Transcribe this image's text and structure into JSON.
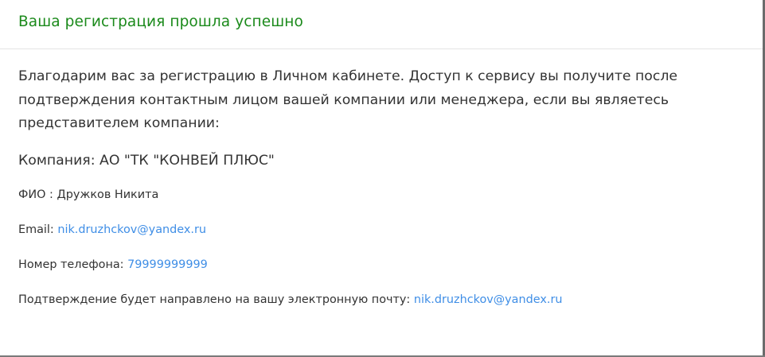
{
  "modal": {
    "title": "Ваша регистрация прошла успешно",
    "intro": "Благодарим вас за регистрацию в Личном кабинете. Доступ к сервису вы получите после подтверждения контактным лицом вашей компании или менеджера, если вы являетесь представителем компании:",
    "company": "Компания: АО \"ТК \"КОНВЕЙ ПЛЮС\"",
    "fio": "ФИО : Дружков Никита",
    "email_label": "Email: ",
    "email_value": "nik.druzhckov@yandex.ru",
    "phone_label": "Номер телефона: ",
    "phone_value": "79999999999",
    "confirm_label": "Подтверждение будет направлено на вашу электронную почту: ",
    "confirm_email": "nik.druzhckov@yandex.ru"
  },
  "colors": {
    "title": "#1b8a1b",
    "link": "#3f8ee6",
    "text": "#333333",
    "backdrop": "#5a5a5a"
  }
}
